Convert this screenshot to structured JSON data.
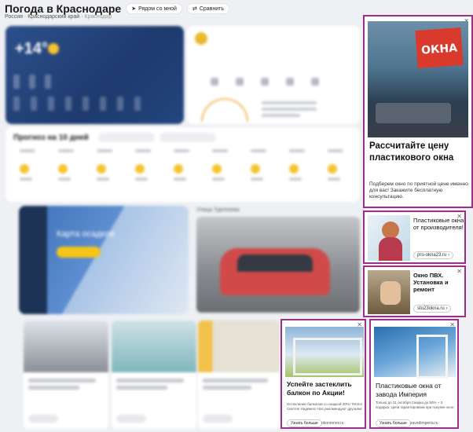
{
  "header": {
    "title": "Погода в Краснодаре",
    "near_me": "Рядом со мной",
    "compare": "Сравнить",
    "crumbs": [
      "Россия",
      "Краснодарский край",
      "Краснодар"
    ]
  },
  "now": {
    "temp": "+14°"
  },
  "forecast": {
    "title": "Прогноз на 10 дней"
  },
  "map": {
    "title": "Карта осадков"
  },
  "camera": {
    "title": "Улица Тургенева"
  },
  "ads": {
    "ad1": {
      "sign": "ОКНА",
      "headline": "Рассчитайте цену пластикового окна",
      "body": "Подберем окно по приятной цене именно для вас! Закажите бесплатную консультацию."
    },
    "ad2": {
      "title": "Пластиковые окна от производителя!",
      "domain": "pro-okna23.ru"
    },
    "ad3": {
      "title": "Окно ПВХ. Установка и ремонт",
      "domain": "sto23okna.ru"
    },
    "ad4": {
      "title": "Успейте застеклить балкон по Акции!",
      "body": "Остекление балконов со скидкой 40%! Тепло! Светло! Надежно! Нас рекомендуют друзьям!",
      "button": "Узнать больше",
      "domain": "okonmnov.ru"
    },
    "ad5": {
      "title": "Пластиковые окна от завода Империя",
      "body": "Только до 31 октября Скидка до 50% + 3 подарка. Цена гарантирована при покупке окон",
      "button": "Узнать больше",
      "domain": "zavodimperia.ru"
    }
  }
}
